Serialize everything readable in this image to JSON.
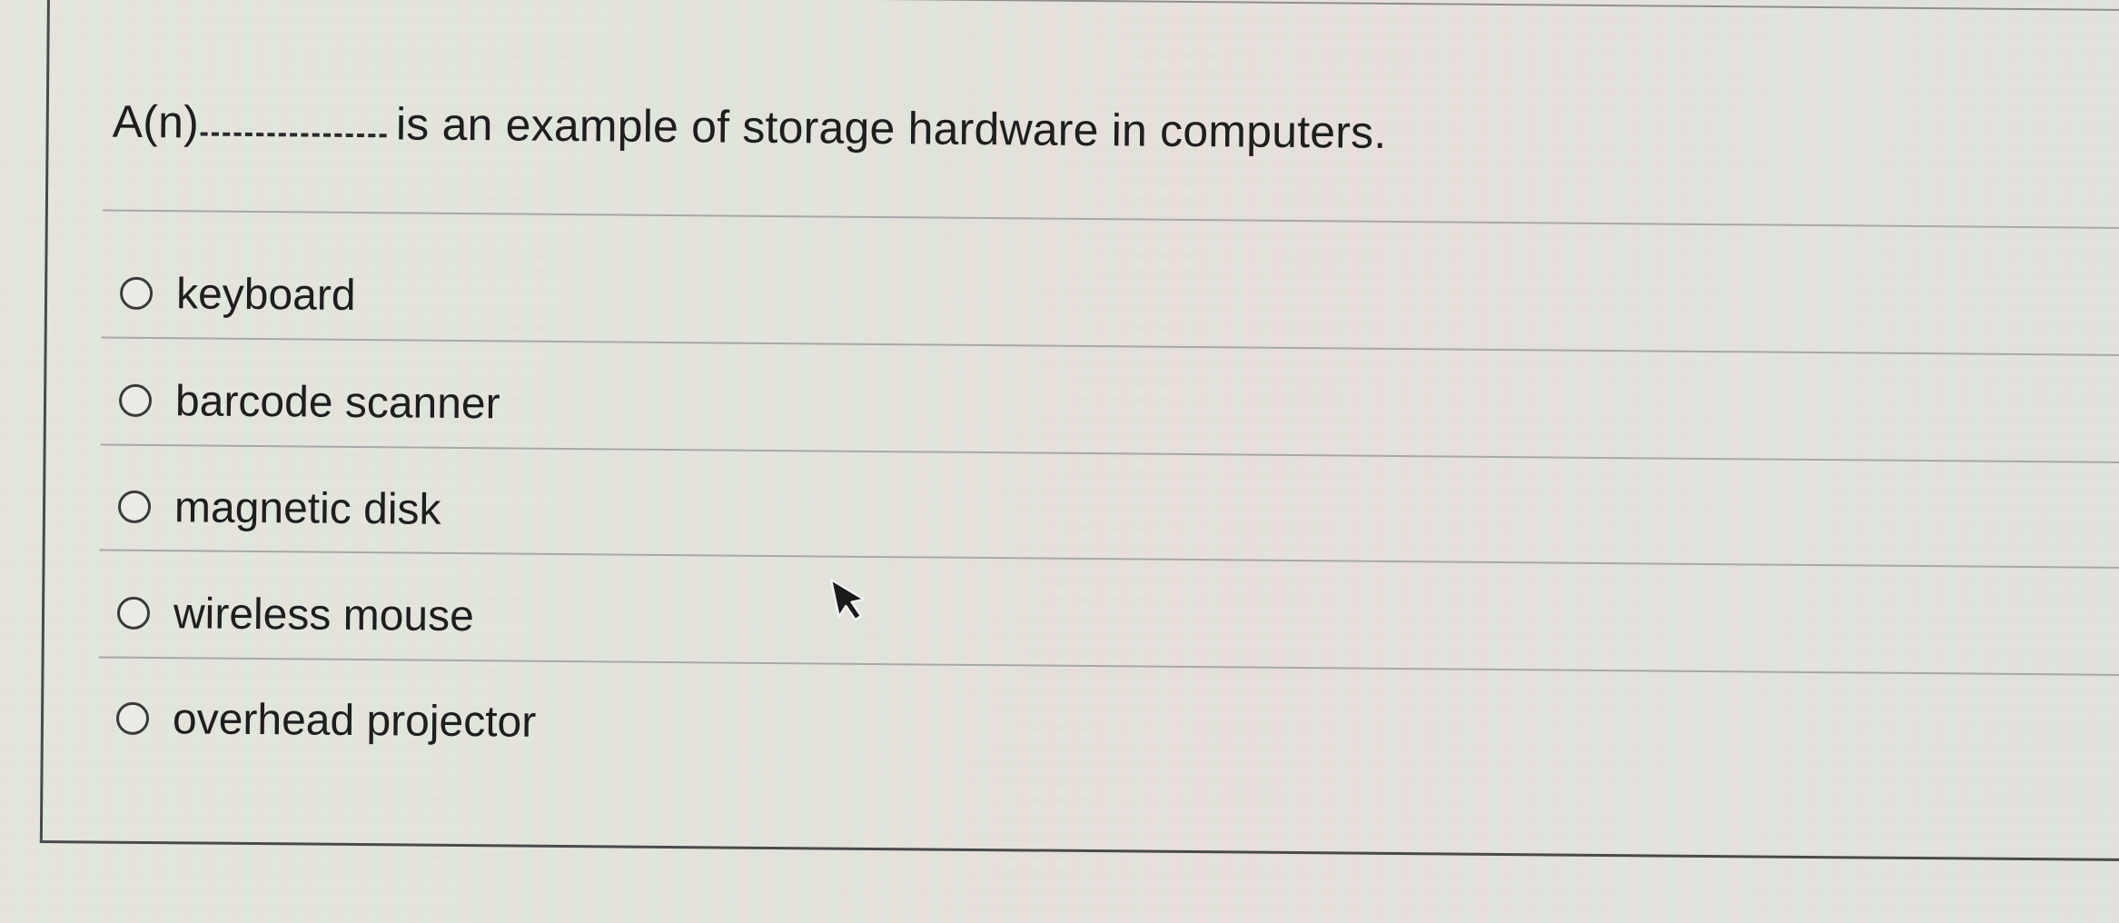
{
  "question": {
    "prefix": "A(n)",
    "suffix": "is an example of storage hardware in computers."
  },
  "options": [
    {
      "label": "keyboard",
      "selected": false
    },
    {
      "label": "barcode scanner",
      "selected": false
    },
    {
      "label": "magnetic disk",
      "selected": false
    },
    {
      "label": "wireless mouse",
      "selected": false
    },
    {
      "label": "overhead projector",
      "selected": false
    }
  ],
  "icons": {
    "radio": "radio-unchecked-icon",
    "cursor": "mouse-pointer-icon"
  }
}
